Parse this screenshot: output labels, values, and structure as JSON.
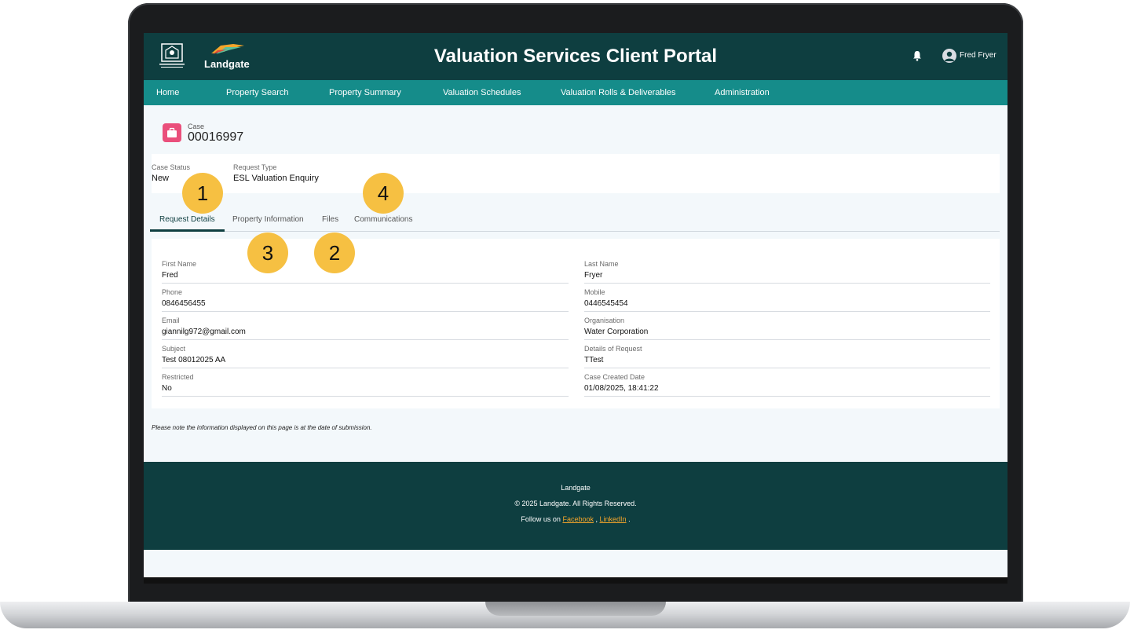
{
  "header": {
    "brand": "Landgate",
    "title": "Valuation Services Client Portal",
    "user_name": "Fred Fryer"
  },
  "nav": {
    "items": [
      {
        "label": "Home"
      },
      {
        "label": "Property Search"
      },
      {
        "label": "Property Summary"
      },
      {
        "label": "Valuation Schedules"
      },
      {
        "label": "Valuation Rolls & Deliverables"
      },
      {
        "label": "Administration"
      }
    ]
  },
  "case": {
    "label": "Case",
    "number": "00016997",
    "status_label": "Case Status",
    "status_value": "New",
    "request_type_label": "Request Type",
    "request_type_value": "ESL Valuation Enquiry"
  },
  "tabs": [
    {
      "label": "Request Details",
      "active": true
    },
    {
      "label": "Property Information"
    },
    {
      "label": "Files"
    },
    {
      "label": "Communications"
    }
  ],
  "details": {
    "left": [
      {
        "label": "First Name",
        "value": "Fred"
      },
      {
        "label": "Phone",
        "value": "0846456455"
      },
      {
        "label": "Email",
        "value": "giannilg972@gmail.com"
      },
      {
        "label": "Subject",
        "value": "Test 08012025 AA"
      },
      {
        "label": "Restricted",
        "value": "No"
      }
    ],
    "right": [
      {
        "label": "Last Name",
        "value": "Fryer"
      },
      {
        "label": "Mobile",
        "value": "0446545454"
      },
      {
        "label": "Organisation",
        "value": "Water Corporation"
      },
      {
        "label": "Details of Request",
        "value": "TTest"
      },
      {
        "label": "Case Created Date",
        "value": "01/08/2025, 18:41:22"
      }
    ]
  },
  "note": "Please note the information displayed on this page is at the date of submission.",
  "footer": {
    "company": "Landgate",
    "copyright": "© 2025 Landgate. All Rights Reserved.",
    "follow_prefix": "Follow us on",
    "facebook": "Facebook",
    "separator": ",",
    "linkedin": "LinkedIn",
    "suffix": "."
  },
  "markers": [
    "1",
    "2",
    "3",
    "4"
  ],
  "colors": {
    "header_bg": "#0e3e40",
    "nav_bg": "#158c8a",
    "case_icon": "#ea4f7b",
    "marker": "#f6c042",
    "link": "#f4a52a"
  }
}
